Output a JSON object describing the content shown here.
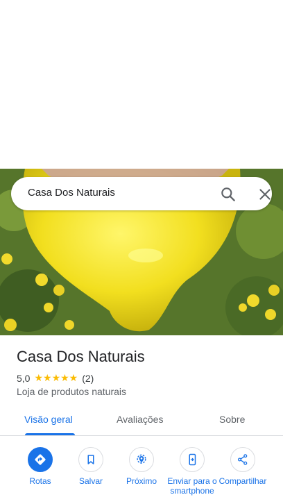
{
  "search": {
    "query": "Casa Dos Naturais"
  },
  "place": {
    "name": "Casa Dos Naturais",
    "rating": "5,0",
    "stars": "★★★★★",
    "review_count": "(2)",
    "category": "Loja de produtos naturais"
  },
  "tabs": [
    {
      "label": "Visão geral",
      "active": true
    },
    {
      "label": "Avaliações",
      "active": false
    },
    {
      "label": "Sobre",
      "active": false
    }
  ],
  "actions": [
    {
      "label": "Rotas",
      "icon": "directions-icon"
    },
    {
      "label": "Salvar",
      "icon": "bookmark-icon"
    },
    {
      "label": "Próximo",
      "icon": "nearby-icon"
    },
    {
      "label": "Enviar para o smartphone",
      "icon": "send-to-phone-icon"
    },
    {
      "label": "Compartilhar",
      "icon": "share-icon"
    }
  ],
  "colors": {
    "accent": "#1a73e8",
    "star": "#fbbc04"
  }
}
